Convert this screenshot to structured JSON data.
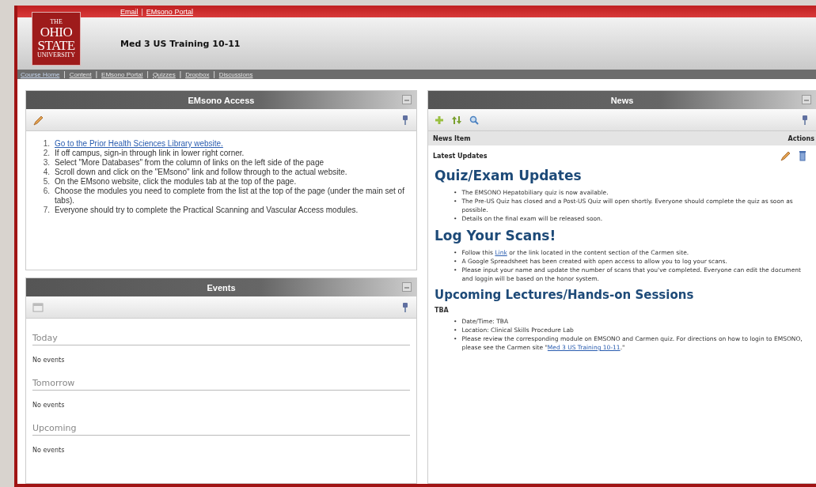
{
  "top_links": [
    {
      "label": "Email"
    },
    {
      "separator": "|",
      "label": "EMsono Portal"
    }
  ],
  "logo": {
    "lines": [
      "THE",
      "OHIO",
      "STATE",
      "UNIVERSITY"
    ]
  },
  "course_title": "Med 3 US Training 10-11",
  "nav": [
    {
      "label": "Course Home",
      "selected": true
    },
    {
      "separator": "|",
      "label": "Content",
      "selected": false
    },
    {
      "separator": "|",
      "label": "EMsono Portal",
      "selected": false
    },
    {
      "separator": "|",
      "label": "Quizzes",
      "selected": false
    },
    {
      "separator": "|",
      "label": "Dropbox",
      "selected": false
    },
    {
      "separator": "|",
      "label": "Discussions",
      "selected": false
    }
  ],
  "emsono_panel": {
    "title": "EMsono Access",
    "steps": [
      {
        "number": "1.",
        "link": "Go to the Prior Health Sciences Library website."
      },
      {
        "number": "2.",
        "text": "If off campus, sign-in through link in lower right corner."
      },
      {
        "number": "3.",
        "text": "Select \"More Databases\" from the column of links on the left side of the page"
      },
      {
        "number": "4.",
        "text": "Scroll down and click on the \"EMsono\" link and follow through to the actual website."
      },
      {
        "number": "5.",
        "text": "On the EMsono website, click the modules tab at the top of the page."
      },
      {
        "number": "6.",
        "text": "Choose the modules you need to complete from the list at the top of the page (under the main set of tabs)."
      },
      {
        "number": "7.",
        "text": "Everyone should try to complete the Practical Scanning and Vascular Access modules."
      }
    ]
  },
  "events_panel": {
    "title": "Events",
    "groups": [
      {
        "heading": "Today",
        "text": "No events"
      },
      {
        "heading": "Tomorrow",
        "text": "No events"
      },
      {
        "heading": "Upcoming",
        "text": "No events"
      }
    ]
  },
  "news_panel": {
    "title": "News",
    "columns": [
      "News Item",
      "Actions"
    ],
    "item": "Latest Updates",
    "sections": [
      {
        "kind": "heading",
        "text": "Quiz/Exam Updates"
      },
      {
        "kind": "bullets",
        "items": [
          {
            "bullet": "•",
            "text": "The EMSONO Hepatobiliary quiz is now available."
          },
          {
            "bullet": "•",
            "text": "The Pre-US Quiz has closed and a Post-US Quiz will open shortly. Everyone should complete the quiz as soon as possible."
          },
          {
            "bullet": "•",
            "text": "Details on the final exam will be released soon."
          }
        ]
      },
      {
        "kind": "heading",
        "text": "Log Your Scans!"
      },
      {
        "kind": "bullets",
        "items": [
          {
            "bullet": "•",
            "text": "Follow this ",
            "link": "Link",
            "text_after": " or the link located in the content section of the Carmen site."
          },
          {
            "bullet": "•",
            "text": "A Google Spreadsheet has been created with open access to allow you to log your scans."
          },
          {
            "bullet": "•",
            "text": "Please input your name and update the number of scans that you've completed. Everyone can edit the document and loggin will be based on the honor system."
          }
        ]
      },
      {
        "kind": "subheading",
        "text": "Upcoming Lectures/Hands-on Sessions"
      },
      {
        "kind": "label",
        "text": "TBA"
      },
      {
        "kind": "bullets",
        "items": [
          {
            "bullet": "•",
            "text": "Date/Time: TBA"
          },
          {
            "bullet": "•",
            "text": "Location: Clinical Skills Procedure Lab"
          },
          {
            "bullet": "•",
            "text": "Please review the corresponding module on EMSONO and Carmen quiz.  For directions on how to login to EMSONO, please see the Carmen site \"",
            "link": "Med 3 US Training 10-11",
            "text_after": ".\""
          }
        ]
      }
    ]
  }
}
